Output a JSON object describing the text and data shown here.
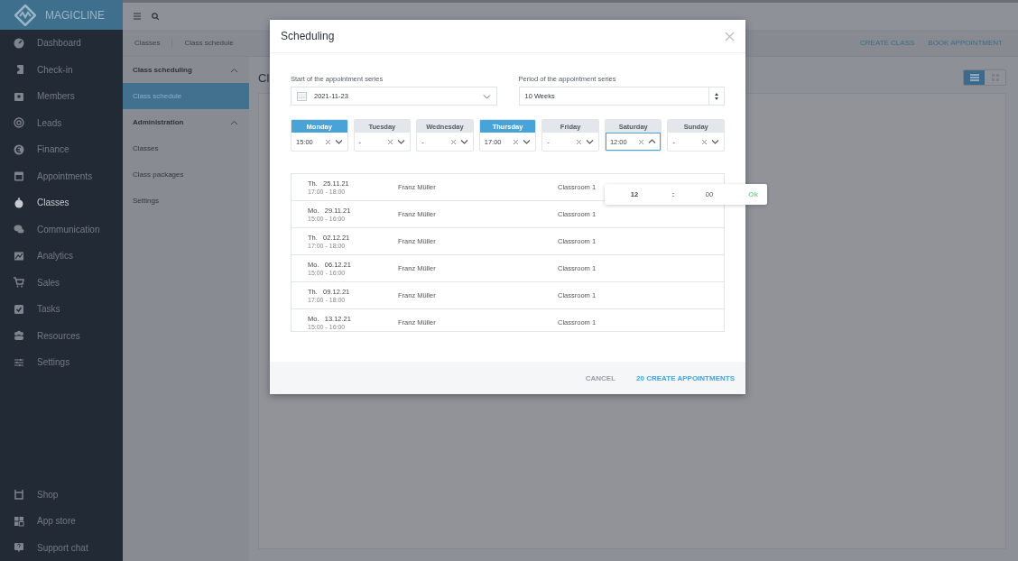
{
  "app": {
    "logo": "MAGICLINE"
  },
  "sidebar": {
    "items": [
      {
        "label": "Dashboard",
        "selected": false
      },
      {
        "label": "Check-in",
        "selected": false
      },
      {
        "label": "Members",
        "selected": false
      },
      {
        "label": "Leads",
        "selected": false
      },
      {
        "label": "Finance",
        "selected": false
      },
      {
        "label": "Appointments",
        "selected": false
      },
      {
        "label": "Classes",
        "selected": true
      },
      {
        "label": "Communication",
        "selected": false
      },
      {
        "label": "Analytics",
        "selected": false
      },
      {
        "label": "Sales",
        "selected": false
      },
      {
        "label": "Tasks",
        "selected": false
      },
      {
        "label": "Resources",
        "selected": false
      },
      {
        "label": "Settings",
        "selected": false
      }
    ],
    "bottom_items": [
      {
        "label": "Shop"
      },
      {
        "label": "App store"
      },
      {
        "label": "Support chat"
      }
    ]
  },
  "breadcrumb": [
    "Classes",
    "Class schedule"
  ],
  "header_actions": [
    "CREATE CLASS",
    "BOOK APPOINTMENT"
  ],
  "subnav": {
    "sections": [
      {
        "title": "Class scheduling",
        "expanded": true,
        "items": [
          {
            "label": "Class schedule",
            "selected": true
          }
        ]
      },
      {
        "title": "Administration",
        "expanded": true,
        "items": [
          {
            "label": "Classes",
            "selected": false
          },
          {
            "label": "Class packages",
            "selected": false
          },
          {
            "label": "Settings",
            "selected": false
          }
        ]
      }
    ]
  },
  "page": {
    "title": "Cl",
    "view_toggle": [
      {
        "kind": "list",
        "selected": true
      },
      {
        "kind": "grid",
        "selected": false
      }
    ]
  },
  "dialog": {
    "title": "Scheduling",
    "start": {
      "label": "Start of the appointment series",
      "value": "2021-11-23"
    },
    "period": {
      "label": "Period of the appointment series",
      "value": "10 Weeks"
    },
    "days": [
      {
        "name": "Monday",
        "selected": true,
        "value": "15:00",
        "open": false
      },
      {
        "name": "Tuesday",
        "selected": false,
        "value": "-",
        "open": false
      },
      {
        "name": "Wednesday",
        "selected": false,
        "value": "-",
        "open": false
      },
      {
        "name": "Thursday",
        "selected": true,
        "value": "17:00",
        "open": false
      },
      {
        "name": "Friday",
        "selected": false,
        "value": "-",
        "open": false
      },
      {
        "name": "Saturday",
        "selected": false,
        "value": "12:00",
        "open": true
      },
      {
        "name": "Sunday",
        "selected": false,
        "value": "-",
        "open": false
      }
    ],
    "time_picker": {
      "hour": "12",
      "separator": ":",
      "minute": "00",
      "ok": "Ok"
    },
    "appointments": [
      {
        "weekday": "Th.",
        "date": "25.11.21",
        "time": "17:00 - 18:00",
        "trainer": "Franz Müller",
        "room": "Classroom 1"
      },
      {
        "weekday": "Mo.",
        "date": "29.11.21",
        "time": "15:00 - 16:00",
        "trainer": "Franz Müller",
        "room": "Classroom 1"
      },
      {
        "weekday": "Th.",
        "date": "02.12.21",
        "time": "17:00 - 18:00",
        "trainer": "Franz Müller",
        "room": "Classroom 1"
      },
      {
        "weekday": "Mo.",
        "date": "06.12.21",
        "time": "15:00 - 16:00",
        "trainer": "Franz Müller",
        "room": "Classroom 1"
      },
      {
        "weekday": "Th.",
        "date": "09.12.21",
        "time": "17:00 - 18:00",
        "trainer": "Franz Müller",
        "room": "Classroom 1"
      },
      {
        "weekday": "Mo.",
        "date": "13.12.21",
        "time": "15:00 - 16:00",
        "trainer": "Franz Müller",
        "room": "Classroom 1"
      }
    ],
    "buttons": {
      "cancel": "CANCEL",
      "confirm": "20 CREATE APPOINTMENTS"
    }
  }
}
